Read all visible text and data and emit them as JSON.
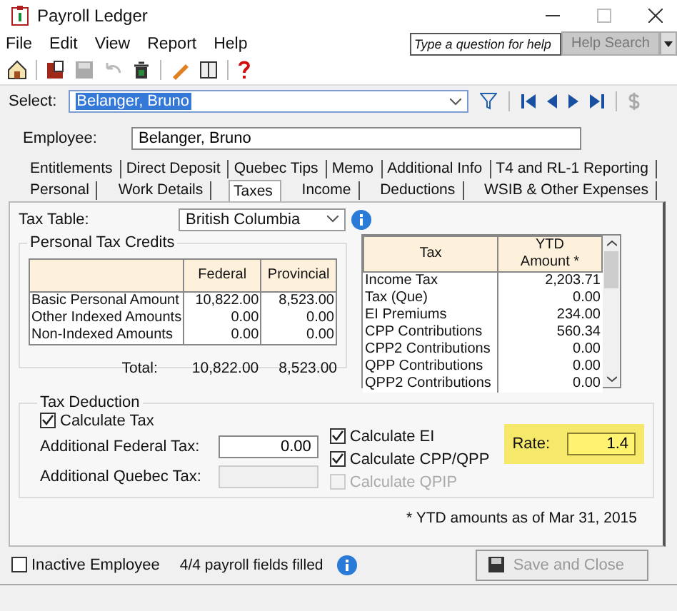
{
  "window": {
    "title": "Payroll Ledger"
  },
  "menu": [
    "File",
    "Edit",
    "View",
    "Report",
    "Help"
  ],
  "help_search": {
    "placeholder": "Type a question for help",
    "button": "Help Search"
  },
  "select": {
    "label": "Select:",
    "value": "Belanger, Bruno"
  },
  "employee": {
    "label": "Employee:",
    "value": "Belanger, Bruno"
  },
  "tab_rows": [
    {
      "tabs": [
        {
          "label": "Entitlements",
          "selected": false
        },
        {
          "label": "Direct Deposit",
          "selected": false
        },
        {
          "label": "Quebec Tips",
          "selected": false
        },
        {
          "label": "Memo",
          "selected": false
        },
        {
          "label": "Additional Info",
          "selected": false
        },
        {
          "label": "T4 and RL-1 Reporting",
          "selected": false
        }
      ]
    },
    {
      "tabs": [
        {
          "label": "Personal",
          "selected": false
        },
        {
          "label": "Work Details",
          "selected": false
        },
        {
          "label": "Taxes",
          "selected": true
        },
        {
          "label": "Income",
          "selected": false
        },
        {
          "label": "Deductions",
          "selected": false
        },
        {
          "label": "WSIB & Other Expenses",
          "selected": false
        }
      ]
    }
  ],
  "tax_table": {
    "label": "Tax Table:",
    "value": "British Columbia"
  },
  "personal_tax_credits": {
    "title": "Personal Tax Credits",
    "columns": [
      "Federal",
      "Provincial"
    ],
    "rows": [
      {
        "label": "Basic Personal Amount",
        "federal": "10,822.00",
        "provincial": "8,523.00"
      },
      {
        "label": "Other Indexed Amounts",
        "federal": "0.00",
        "provincial": "0.00"
      },
      {
        "label": "Non-Indexed Amounts",
        "federal": "0.00",
        "provincial": "0.00"
      }
    ],
    "total": {
      "label": "Total:",
      "federal": "10,822.00",
      "provincial": "8,523.00"
    }
  },
  "ytd_table": {
    "columns": [
      "Tax",
      "YTD Amount *"
    ],
    "rows": [
      {
        "tax": "Income Tax",
        "amount": "2,203.71"
      },
      {
        "tax": "Tax (Que)",
        "amount": "0.00"
      },
      {
        "tax": "EI Premiums",
        "amount": "234.00"
      },
      {
        "tax": "CPP Contributions",
        "amount": "560.34"
      },
      {
        "tax": "CPP2 Contributions",
        "amount": "0.00"
      },
      {
        "tax": "QPP Contributions",
        "amount": "0.00"
      },
      {
        "tax": "QPP2 Contributions",
        "amount": "0.00"
      }
    ]
  },
  "tax_deduction": {
    "title": "Tax Deduction",
    "calculate_tax": {
      "label": "Calculate Tax",
      "checked": true
    },
    "fields": [
      {
        "label": "Additional Federal Tax:",
        "value": "0.00",
        "disabled": false
      },
      {
        "label": "Additional Quebec Tax:",
        "disabled": true
      }
    ],
    "checks": [
      {
        "label": "Calculate EI",
        "checked": true,
        "disabled": false
      },
      {
        "label": "Calculate CPP/QPP",
        "checked": true,
        "disabled": false
      },
      {
        "label": "Calculate QPIP",
        "checked": false,
        "disabled": true
      }
    ],
    "rate": {
      "label": "Rate:",
      "value": "1.4"
    }
  },
  "footnote": "* YTD amounts as of Mar 31, 2015",
  "inactive": {
    "label": "Inactive Employee",
    "checked": false
  },
  "fields_filled": "4/4 payroll fields filled",
  "save_button": {
    "label": "Save and Close",
    "disabled": true
  }
}
